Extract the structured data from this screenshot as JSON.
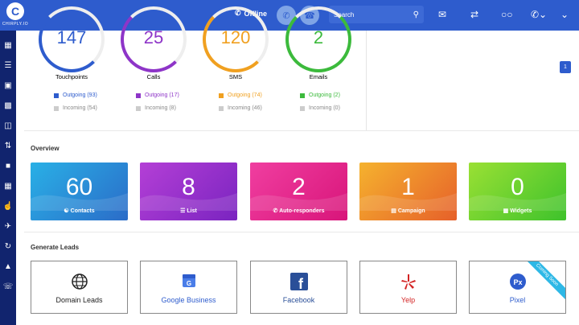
{
  "header": {
    "logo_letter": "C",
    "logo_text": "CHIRPLY.IO",
    "status": "Offline",
    "search_placeholder": "Search"
  },
  "stats": [
    {
      "value": "147",
      "label": "Touchpoints",
      "color": "#2e5ccd",
      "outgoing_label": "Outgoing (93)",
      "incoming_label": "Incoming (54)"
    },
    {
      "value": "25",
      "label": "Calls",
      "color": "#8e35c8",
      "outgoing_label": "Outgoing (17)",
      "incoming_label": "Incoming (8)"
    },
    {
      "value": "120",
      "label": "SMS",
      "color": "#f0a020",
      "outgoing_label": "Outgoing (74)",
      "incoming_label": "Incoming (46)"
    },
    {
      "value": "2",
      "label": "Emails",
      "color": "#3cba3c",
      "outgoing_label": "Outgoing (2)",
      "incoming_label": "Incoming (0)"
    }
  ],
  "pagination": {
    "current": "1"
  },
  "overview": {
    "title": "Overview",
    "cards": [
      {
        "value": "60",
        "label": "Contacts"
      },
      {
        "value": "8",
        "label": "List"
      },
      {
        "value": "2",
        "label": "Auto-responders"
      },
      {
        "value": "1",
        "label": "Campaign"
      },
      {
        "value": "0",
        "label": "Widgets"
      }
    ]
  },
  "leads": {
    "title": "Generate Leads",
    "items": [
      {
        "label": "Domain Leads",
        "icon": "globe-icon"
      },
      {
        "label": "Google Business",
        "icon": "google-business-icon"
      },
      {
        "label": "Facebook",
        "icon": "facebook-icon"
      },
      {
        "label": "Yelp",
        "icon": "yelp-icon"
      },
      {
        "label": "Pixel",
        "icon": "pixel-icon",
        "ribbon": "Coming Soon"
      }
    ]
  }
}
